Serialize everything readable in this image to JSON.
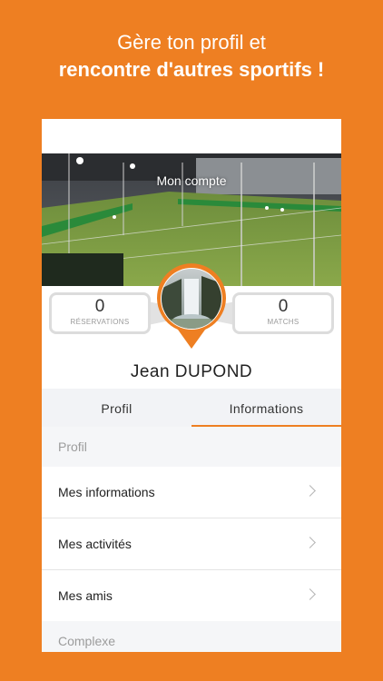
{
  "promo": {
    "line1": "Gère ton profil et",
    "line2": "rencontre d'autres sportifs !"
  },
  "cover": {
    "title": "Mon compte"
  },
  "stats": {
    "reservations": {
      "value": "0",
      "label": "RÉSERVATIONS"
    },
    "matchs": {
      "value": "0",
      "label": "MATCHS"
    }
  },
  "user": {
    "name": "Jean  DUPOND"
  },
  "tabs": [
    {
      "label": "Profil",
      "active": false
    },
    {
      "label": "Informations",
      "active": true
    }
  ],
  "sections": [
    {
      "header": "Profil",
      "items": [
        {
          "label": "Mes informations"
        },
        {
          "label": "Mes activités"
        },
        {
          "label": "Mes amis"
        }
      ]
    },
    {
      "header": "Complexe",
      "items": []
    }
  ],
  "colors": {
    "accent": "#EE7F22",
    "background": "#EE7F22"
  }
}
